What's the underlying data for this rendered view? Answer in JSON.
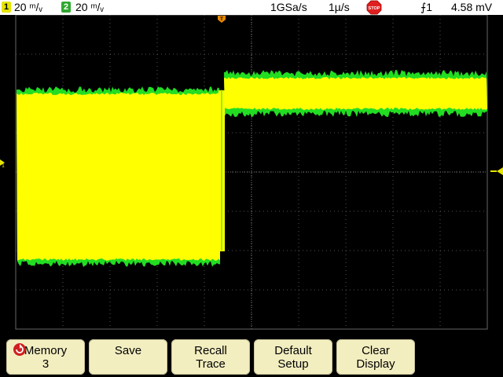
{
  "status_bar": {
    "ch1": {
      "number": "1",
      "scale": "20 ᵐ/ᵥ",
      "color": "#e5e500"
    },
    "ch2": {
      "number": "2",
      "scale": "20 ᵐ/ᵥ",
      "color": "#2fa82f"
    },
    "sample_rate": "1GSa/s",
    "time_scale": "1µ/s",
    "run_state_icon": "stop-icon",
    "run_state_text": "STOP",
    "trigger": "⨍1",
    "trigger_level": "4.58 mV"
  },
  "waveforms": {
    "ch1_color": "#ffff00",
    "ch2_color": "#22dd22",
    "background": "#000000",
    "grid_color": "#555555"
  },
  "softkeys": [
    {
      "id": "memory",
      "line1": "Memory",
      "line2": "3",
      "icon": "rotate-icon"
    },
    {
      "id": "save",
      "line1": "Save",
      "line2": ""
    },
    {
      "id": "recall",
      "line1": "Recall",
      "line2": "Trace"
    },
    {
      "id": "default",
      "line1": "Default",
      "line2": "Setup"
    },
    {
      "id": "clear",
      "line1": "Clear",
      "line2": "Display"
    }
  ]
}
